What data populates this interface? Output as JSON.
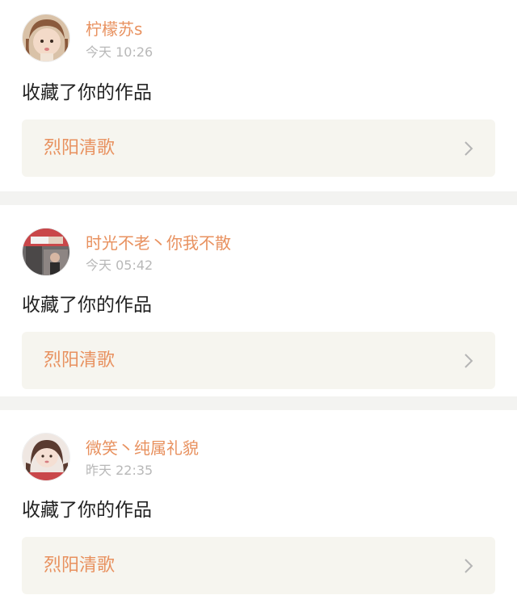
{
  "colors": {
    "accent": "#e8915f",
    "timestamp": "#b8b8b8",
    "text": "#222222",
    "link_bg": "#f6f5ef",
    "divider": "#f3f3f1"
  },
  "notifications": [
    {
      "username": "柠檬苏s",
      "time": "今天 10:26",
      "action": "收藏了你的作品",
      "work_title": "烈阳清歌",
      "avatar_icon": "avatar-girl-icon"
    },
    {
      "username": "时光不老丶你我不散",
      "time": "今天 05:42",
      "action": "收藏了你的作品",
      "work_title": "烈阳清歌",
      "avatar_icon": "avatar-photo-icon"
    },
    {
      "username": "微笑丶纯属礼貌",
      "time": "昨天 22:35",
      "action": "收藏了你的作品",
      "work_title": "烈阳清歌",
      "avatar_icon": "avatar-girl-icon"
    }
  ]
}
